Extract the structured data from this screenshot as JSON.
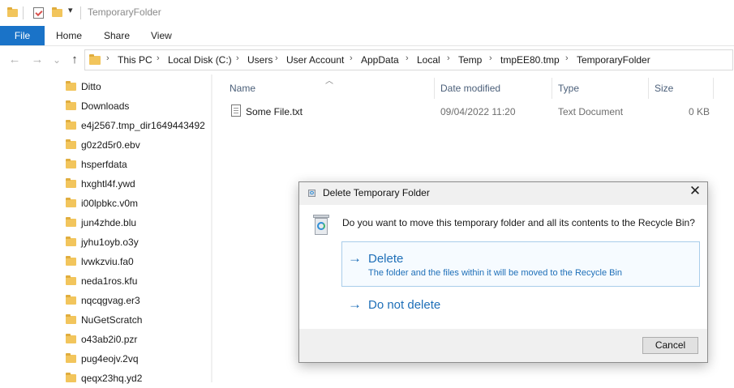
{
  "window": {
    "title": "TemporaryFolder"
  },
  "ribbon": {
    "file": "File",
    "tabs": [
      "Home",
      "Share",
      "View"
    ]
  },
  "nav": {
    "back": "←",
    "forward": "→",
    "dropdown": "⌄",
    "up": "↑"
  },
  "breadcrumb": [
    "This PC",
    "Local Disk (C:)",
    "Users",
    "User Account",
    "AppData",
    "Local",
    "Temp",
    "tmpEE80.tmp",
    "TemporaryFolder"
  ],
  "tree": [
    "Ditto",
    "Downloads",
    "e4j2567.tmp_dir1649443492",
    "g0z2d5r0.ebv",
    "hsperfdata",
    "hxghtl4f.ywd",
    "i00lpbkc.v0m",
    "jun4zhde.blu",
    "jyhu1oyb.o3y",
    "lvwkzviu.fa0",
    "neda1ros.kfu",
    "nqcqgvag.er3",
    "NuGetScratch",
    "o43ab2i0.pzr",
    "pug4eojv.2vq",
    "qeqx23hq.yd2"
  ],
  "columns": {
    "name": "Name",
    "date": "Date modified",
    "type": "Type",
    "size": "Size"
  },
  "files": [
    {
      "name": "Some File.txt",
      "date": "09/04/2022 11:20",
      "type": "Text Document",
      "size": "0 KB"
    }
  ],
  "dialog": {
    "title": "Delete Temporary Folder",
    "question": "Do you want to move this temporary folder and all its contents to the Recycle Bin?",
    "delete_label": "Delete",
    "delete_desc": "The folder and the files within it will be moved to the Recycle Bin",
    "no_delete_label": "Do not delete",
    "cancel": "Cancel"
  },
  "colors": {
    "accent": "#1a73c8",
    "link": "#1e6fb8",
    "folder": "#f2c55c"
  }
}
